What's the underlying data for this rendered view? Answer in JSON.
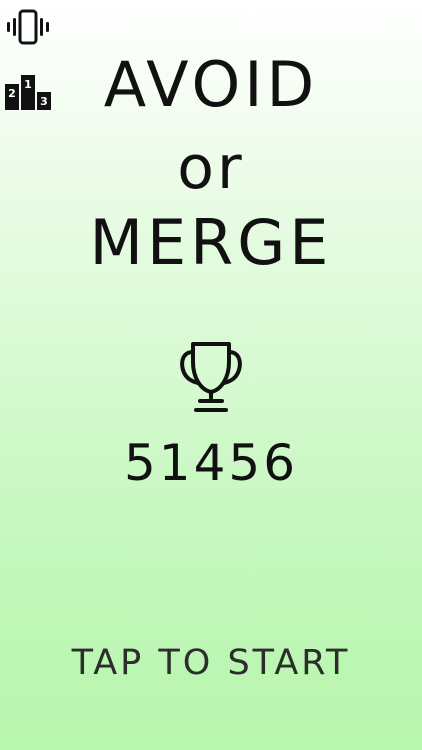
{
  "title": {
    "line1": "AVOID",
    "line2": "or",
    "line3": "MERGE"
  },
  "best_score": "51456",
  "start_label": "TAP TO START",
  "leaderboard_digits": [
    "2",
    "1",
    "3"
  ],
  "icons": {
    "vibrate": "vibrate-icon",
    "leaderboard": "leaderboard-icon",
    "trophy": "trophy-icon"
  },
  "colors": {
    "text": "#111111",
    "start_text": "#2b2e2b",
    "background_top": "#ffffff",
    "background_bottom": "#b8f6ae"
  }
}
